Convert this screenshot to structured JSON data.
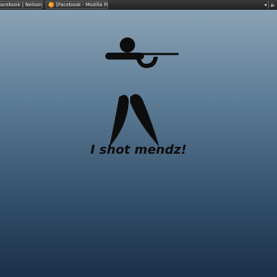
{
  "taskbar": {
    "tasks": [
      {
        "label": "acebook | Nelson Ma...",
        "icon": "window-icon"
      },
      {
        "label": "[Facebook - Mozilla Fire...",
        "icon": "firefox-icon"
      }
    ],
    "tray": {
      "arrow_label": "◂",
      "speaker_label": "🔈"
    }
  },
  "desktop": {
    "wallpaper": {
      "caption": "I shot mendz!",
      "figure_icon": "rifle-shooter-icon",
      "colors": {
        "top": "#8aa2b5",
        "bottom": "#1b3049",
        "figure": "#0d0d0d"
      }
    }
  }
}
